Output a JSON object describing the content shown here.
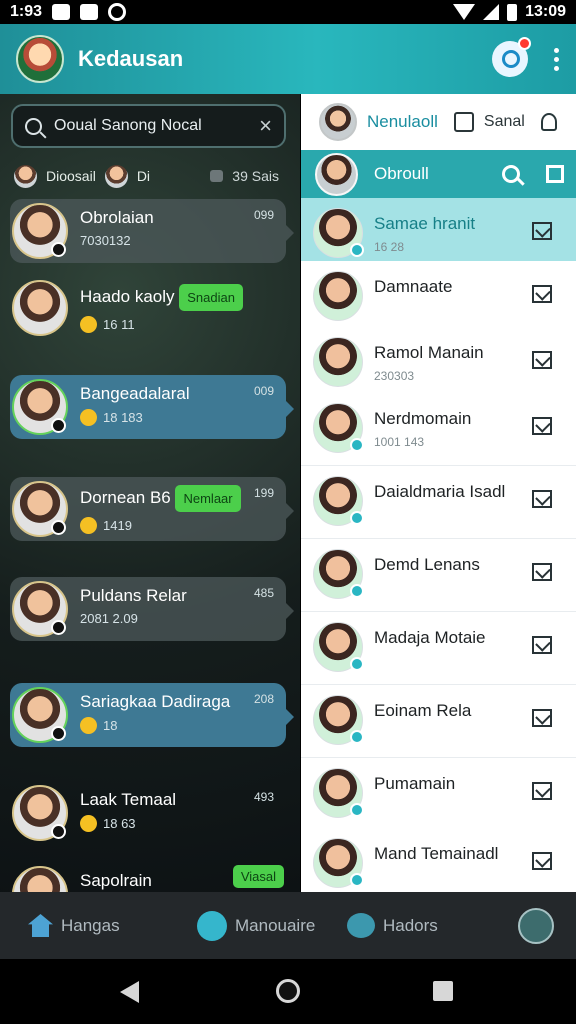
{
  "status": {
    "time_left": "1:93",
    "time_right": "13:09"
  },
  "app": {
    "title": "Kedausan"
  },
  "search": {
    "value": "Ooual Sanong Nocal"
  },
  "group": {
    "name": "Dioosail",
    "label": "Di",
    "count": "39 Sais"
  },
  "chats": [
    {
      "name": "Obrolaian",
      "meta": "7030132",
      "time": "099"
    },
    {
      "name": "Haado kaoly",
      "meta": "16 11",
      "tag": "Snadian"
    },
    {
      "name": "Bangeadalaral",
      "meta": "18 183",
      "time": "009"
    },
    {
      "name": "Dornean",
      "tag": "Nemlaar",
      "tag_prefix": "B6",
      "meta": "1419",
      "time": "199"
    },
    {
      "name": "Puldans Relar",
      "meta": "2081 2.09",
      "time": "485"
    },
    {
      "name": "Sariagkaa Dadiraga",
      "meta": "18",
      "time": "208"
    },
    {
      "name": "Laak Temaal",
      "meta": "18 63",
      "time": "493"
    },
    {
      "name": "Sapolrain",
      "tag": "Viasal"
    }
  ],
  "right_header": {
    "title": "Nenulaoll",
    "label": "Sanal"
  },
  "selected": {
    "name": "Obroull"
  },
  "contacts": [
    {
      "name": "Samae hranit",
      "sub": "16 28"
    },
    {
      "name": "Damnaate",
      "sub": ""
    },
    {
      "name": "Ramol Manain",
      "sub": "230303"
    },
    {
      "name": "Nerdmomain",
      "sub": "1001 143"
    },
    {
      "name": "Daialdmaria Isadl",
      "sub": ""
    },
    {
      "name": "Demd Lenans",
      "sub": ""
    },
    {
      "name": "Madaja Motaie",
      "sub": ""
    },
    {
      "name": "Eoinam Rela",
      "sub": ""
    },
    {
      "name": "Pumamain",
      "sub": ""
    },
    {
      "name": "Mand Temainadl",
      "sub": ""
    }
  ],
  "bottom_nav": {
    "home": "Hangas",
    "messages": "Manouaire",
    "leads": "Hadors"
  }
}
